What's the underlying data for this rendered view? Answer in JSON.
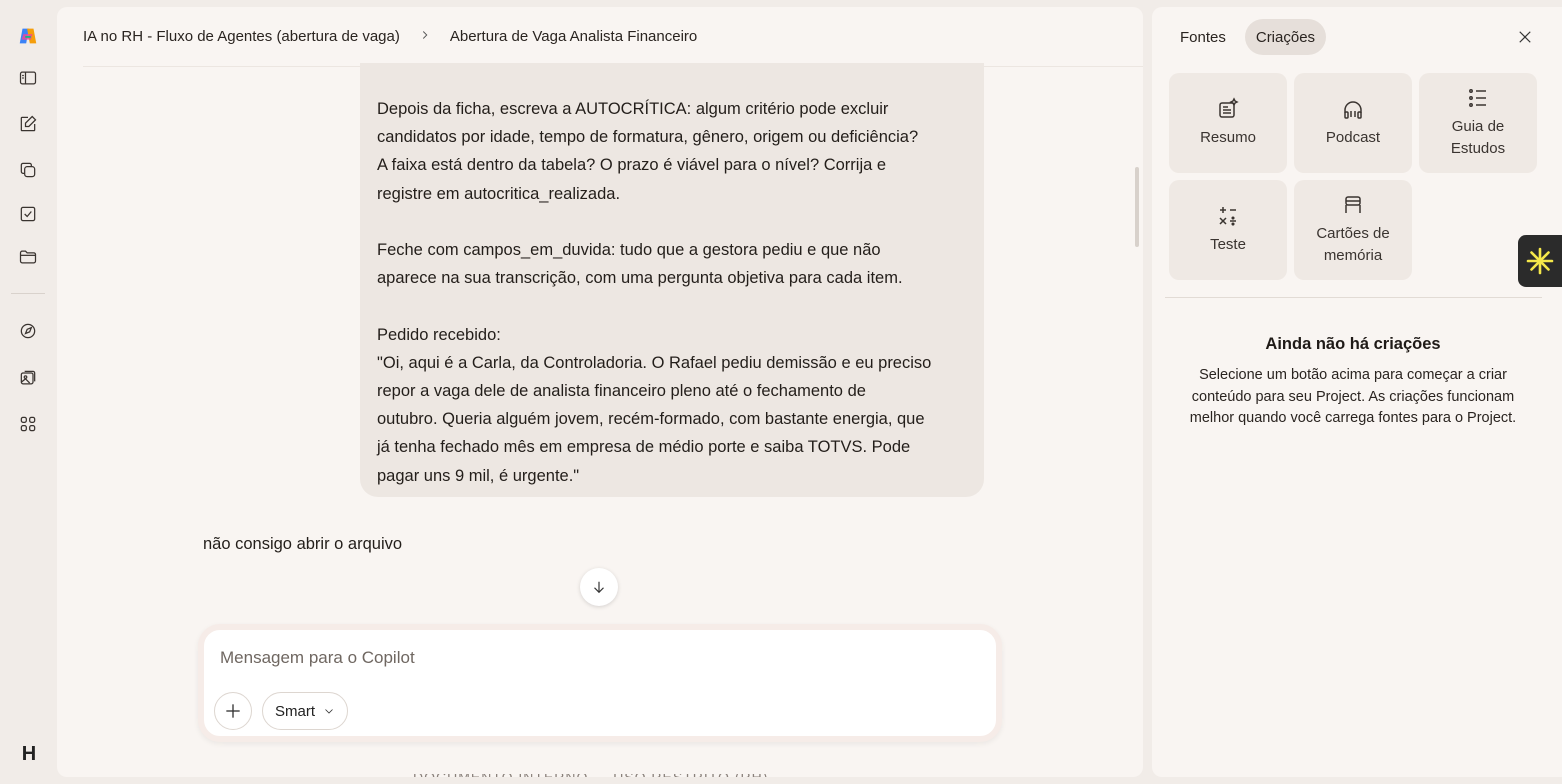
{
  "rail": {
    "icons": [
      "copilot-logo-icon",
      "sidebar-toggle-icon",
      "new-chat-icon",
      "pages-icon",
      "tasks-icon",
      "folder-icon",
      "discover-icon",
      "image-library-icon",
      "apps-icon"
    ],
    "avatar_initial": "H"
  },
  "breadcrumb": {
    "project": "IA no RH - Fluxo de Agentes (abertura de vaga)",
    "separator": ">",
    "current": "Abertura de Vaga Analista Financeiro"
  },
  "chat": {
    "bubble_lines": [
      "Depois da ficha, escreva a AUTOCRÍTICA: algum critério pode excluir",
      "candidatos por idade, tempo de formatura, gênero, origem ou deficiência?",
      "A faixa está dentro da tabela? O prazo é viável para o nível? Corrija e",
      "registre em autocritica_realizada.",
      "",
      "Feche com campos_em_duvida: tudo que a gestora pediu e que não",
      "aparece na sua transcrição, com uma pergunta objetiva para cada item.",
      "",
      "Pedido recebido:",
      "\"Oi, aqui é a Carla, da Controladoria. O Rafael pediu demissão e eu preciso",
      "repor a vaga dele de analista financeiro pleno até o fechamento de",
      "outubro. Queria alguém jovem, recém-formado, com bastante energia, que",
      "já tenha fechado mês em empresa de médio porte e saiba TOTVS. Pode",
      "pagar uns 9 mil, é urgente.\""
    ],
    "user_message": "não consigo abrir o arquivo",
    "cut_off_text": "DOCUMENTO INTERNO — USO RESTRITO (RH)"
  },
  "composer": {
    "placeholder": "Mensagem para o Copilot",
    "mode_label": "Smart"
  },
  "right_panel": {
    "tabs": [
      {
        "label": "Fontes",
        "active": false
      },
      {
        "label": "Criações",
        "active": true
      }
    ],
    "tiles": [
      {
        "label": "Resumo",
        "icon": "summary-icon"
      },
      {
        "label": "Podcast",
        "icon": "headphones-icon"
      },
      {
        "label": "Guia de Estudos",
        "icon": "list-icon"
      },
      {
        "label": "Teste",
        "icon": "math-operators-icon"
      },
      {
        "label": "Cartões de memória",
        "icon": "flashcards-icon"
      }
    ],
    "empty_title": "Ainda não há criações",
    "empty_desc": "Selecione um botão acima para começar a criar conteúdo para seu Project. As criações funcionam melhor quando você carrega fontes para o Project."
  },
  "colors": {
    "background": "#f1ece8",
    "panel": "#f9f5f2",
    "bubble": "#ede7e2",
    "tile": "#efe9e4",
    "active_tab": "#e6dfda"
  }
}
